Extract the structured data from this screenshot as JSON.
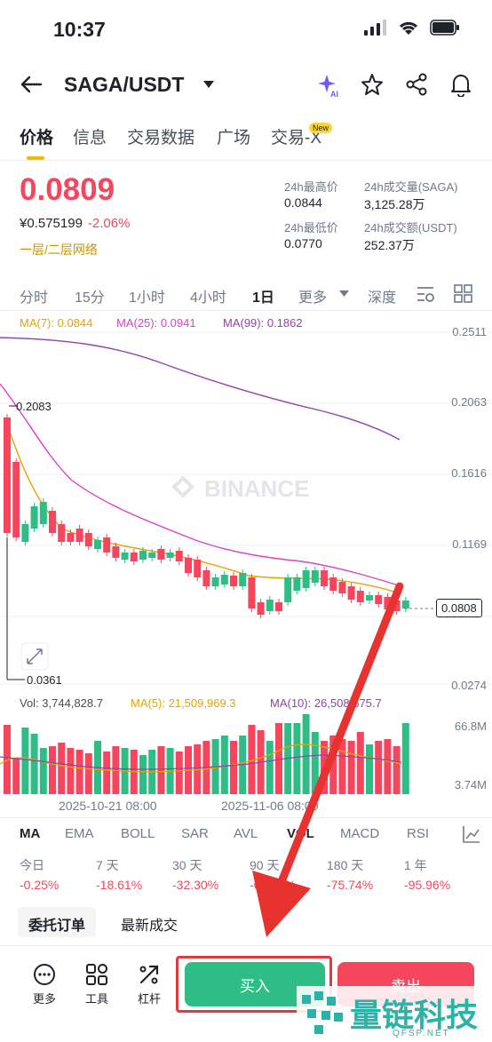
{
  "status": {
    "time": "10:37"
  },
  "header": {
    "pair": "SAGA/USDT"
  },
  "tabs": [
    {
      "label": "价格"
    },
    {
      "label": "信息"
    },
    {
      "label": "交易数据"
    },
    {
      "label": "广场"
    },
    {
      "label": "交易-X"
    }
  ],
  "new_badge": "New",
  "ticker": {
    "price": "0.0809",
    "cny": "¥0.575199",
    "change": "-2.06%",
    "network": "一层/二层网络",
    "high_label": "24h最高价",
    "high": "0.0844",
    "low_label": "24h最低价",
    "low": "0.0770",
    "vol_label": "24h成交量(SAGA)",
    "vol": "3,125.28万",
    "amt_label": "24h成交额(USDT)",
    "amt": "252.37万"
  },
  "intervals": [
    "分时",
    "15分",
    "1小时",
    "4小时",
    "1日",
    "更多",
    "深度"
  ],
  "ma_legend": {
    "ma7": "MA(7): 0.0844",
    "ma25": "MA(25): 0.0941",
    "ma99": "MA(99): 0.1862"
  },
  "price_axis": [
    "0.2511",
    "0.2063",
    "0.1616",
    "0.1169",
    "0.0274"
  ],
  "current_price_tag": "0.0808",
  "markers": {
    "high": "0.2083",
    "low": "0.0361"
  },
  "watermark": "BINANCE",
  "volume_legend": {
    "vol": "Vol: 3,744,828.7",
    "ma5": "MA(5): 21,509,969.3",
    "ma10": "MA(10): 26,508,675.7"
  },
  "volume_axis": [
    "66.8M",
    "3.74M"
  ],
  "date_axis": [
    "2025-10-21 08:00",
    "2025-11-06 08:00"
  ],
  "indicators": [
    "MA",
    "EMA",
    "BOLL",
    "SAR",
    "AVL",
    "VOL",
    "MACD",
    "RSI"
  ],
  "performance": [
    {
      "label": "今日",
      "value": "-0.25%"
    },
    {
      "label": "7 天",
      "value": "-18.61%"
    },
    {
      "label": "30 天",
      "value": "-32.30%"
    },
    {
      "label": "90 天",
      "value": "-67.67%"
    },
    {
      "label": "180 天",
      "value": "-75.74%"
    },
    {
      "label": "1 年",
      "value": "-95.96%"
    }
  ],
  "order_tabs": [
    "委托订单",
    "最新成交"
  ],
  "tools": [
    "更多",
    "工具",
    "杠杆"
  ],
  "actions": {
    "buy": "买入",
    "sell": "卖出"
  },
  "watermark_logo": {
    "name": "量链科技",
    "domain": "QFSP.NET"
  },
  "colors": {
    "up": "#2ebd85",
    "down": "#f6465d",
    "ma7": "#f0b90b",
    "ma25": "#e040c8",
    "ma99": "#8e44ad",
    "accent": "#f0b90b"
  }
}
